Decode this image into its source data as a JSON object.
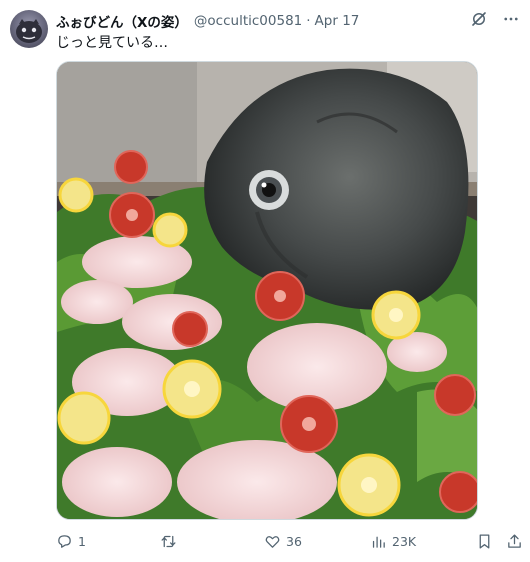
{
  "post": {
    "display_name": "ふぉびどん（Xの姿）",
    "handle": "@occultic00581",
    "separator": "·",
    "date": "Apr 17",
    "text": "じっと見ている…",
    "media": {
      "alt": "Sunfish head displayed on a platter of fish sashimi with lettuce, lemon and tomato slices"
    }
  },
  "actions": {
    "replies": "1",
    "retweets": "",
    "likes": "36",
    "views": "23K"
  },
  "icons": {
    "grok": "grok-icon",
    "more": "more-icon",
    "reply": "reply-icon",
    "retweet": "retweet-icon",
    "like": "heart-icon",
    "views": "views-icon",
    "bookmark": "bookmark-icon",
    "share": "share-icon"
  },
  "colors": {
    "text": "#0f1419",
    "muted": "#536471",
    "border": "#cfd9de"
  }
}
